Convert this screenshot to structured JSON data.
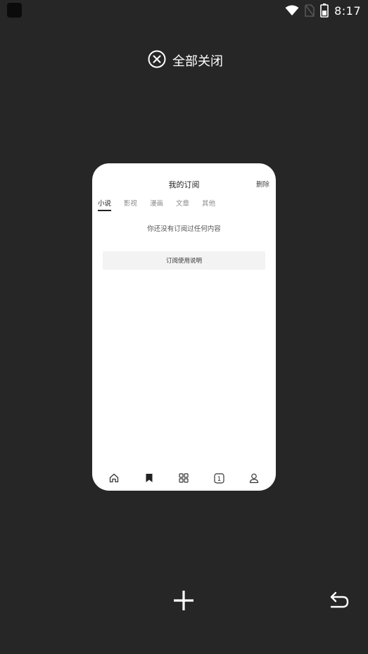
{
  "status_bar": {
    "time": "8:17",
    "icons": [
      "app-icon",
      "wifi-icon",
      "sim-off-icon",
      "battery-icon"
    ]
  },
  "close_all": {
    "label": "全部关闭",
    "icon": "close-circle-icon"
  },
  "tab_card": {
    "page_title": "我的订阅",
    "delete_label": "删除",
    "tabs": [
      {
        "label": "小说",
        "active": true
      },
      {
        "label": "影视",
        "active": false
      },
      {
        "label": "漫画",
        "active": false
      },
      {
        "label": "文章",
        "active": false
      },
      {
        "label": "其他",
        "active": false
      }
    ],
    "empty_message": "你还没有订阅过任何内容",
    "tutorial_button": "订阅使用说明",
    "bottom_nav": [
      "home-icon",
      "bookmark-icon",
      "grid-icon",
      "tabs-count-icon",
      "user-icon"
    ],
    "tab_count": "1"
  },
  "controls": {
    "new_tab_icon": "plus-icon",
    "back_icon": "back-arrow-icon"
  },
  "colors": {
    "background": "#262626",
    "card": "#ffffff",
    "tutorial_button_bg": "#f3f3f3"
  }
}
